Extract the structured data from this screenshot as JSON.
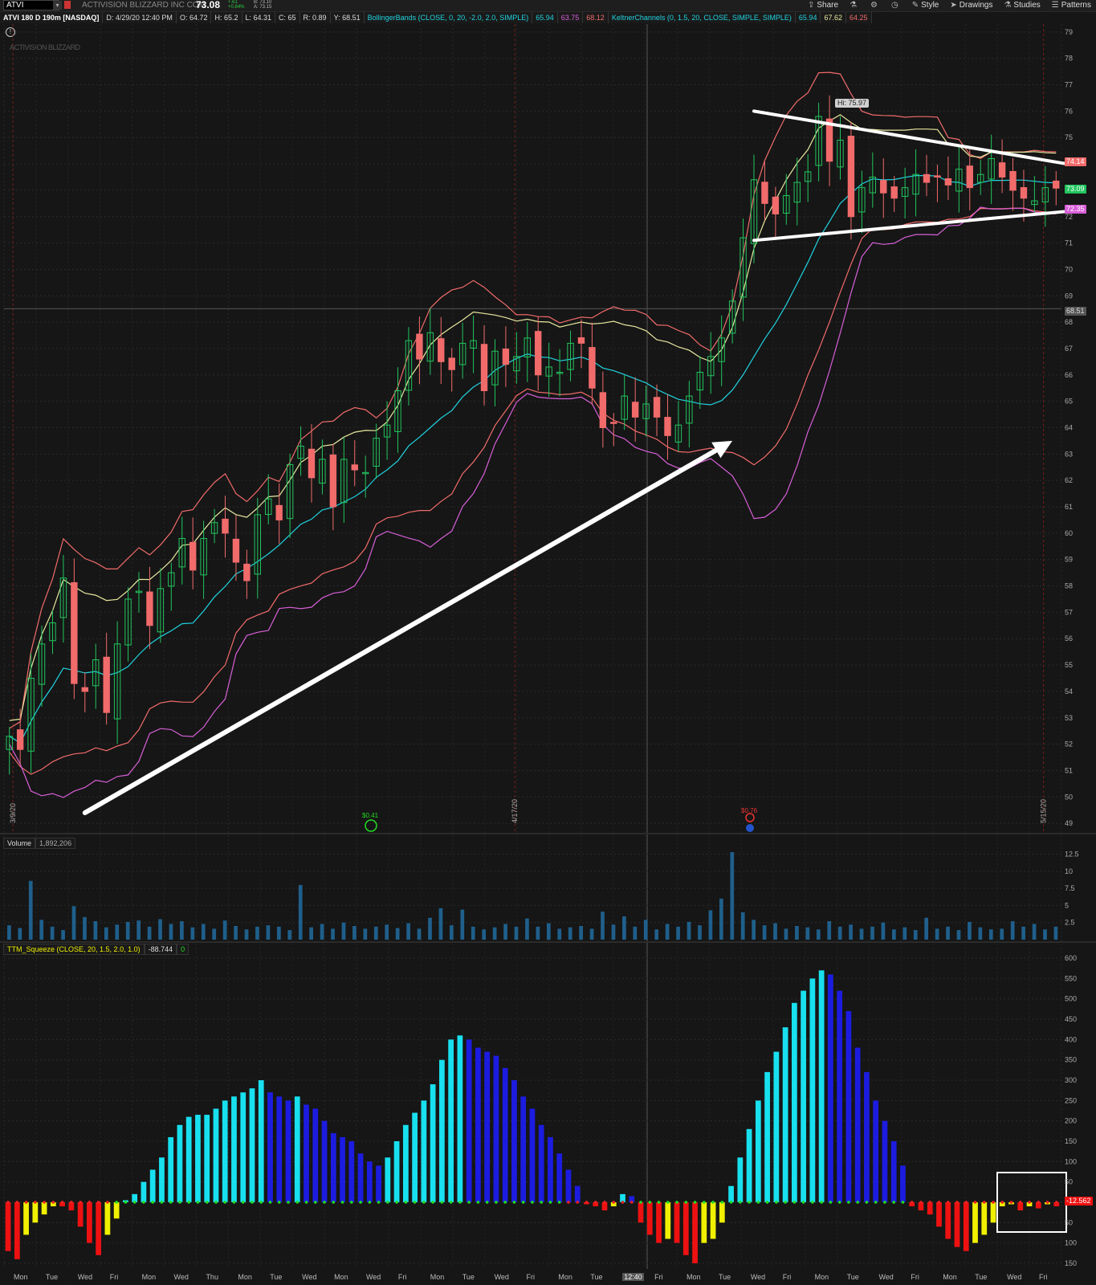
{
  "header": {
    "symbol": "ATVI",
    "company": "ACTIVISION BLIZZARD INC COM",
    "last": "73.08",
    "change": "+.61",
    "change_pct": "+0.84%",
    "bid": "B: 73.10",
    "ask": "A: 73.15",
    "buttons": [
      "Share",
      "Style",
      "Drawings",
      "Studies",
      "Patterns"
    ]
  },
  "infobar": {
    "title": "ATVI 180 D 190m [NASDAQ]",
    "date": "D: 4/29/20 12:40 PM",
    "open": "O: 64.72",
    "high": "H: 65.2",
    "low": "L: 64.31",
    "close": "C: 65",
    "range": "R: 0.89",
    "y": "Y: 68.51",
    "bb_label": "BollingerBands (CLOSE, 0, 20, -2.0, 2.0, SIMPLE)",
    "bb_mid": "65.94",
    "bb_low": "63.75",
    "bb_up": "68.12",
    "kc_label": "KeltnerChannels (0, 1.5, 20, CLOSE, SIMPLE, SIMPLE)",
    "kc_mid": "65.94",
    "kc_up": "67.62",
    "kc_low": "64.25"
  },
  "watermark": "ACTIVISION BLIZZARD",
  "hi_label": "Hi: 75.97",
  "price_tags": {
    "upper": "74.14",
    "last": "73.09",
    "lower": "72.35",
    "cursor": "68.51",
    "squeeze": "-12.562"
  },
  "dividends": {
    "first": "$0.41",
    "second": "$0.76"
  },
  "date_markers": [
    "3/9/20",
    "4/17/20",
    "5/15/20"
  ],
  "volume_label": "Volume",
  "volume_value": "1,892,206",
  "ttm_label": "TTM_Squeeze (CLOSE, 20, 1.5, 2.0, 1.0)",
  "ttm_value": "-88.744",
  "ttm_alert": "0",
  "x_labels": [
    "Mon",
    "Tue",
    "Wed",
    "Fri",
    "Mon",
    "Wed",
    "Thu",
    "Mon",
    "Tue",
    "Wed",
    "Mon",
    "Wed",
    "Fri",
    "Mon",
    "Tue",
    "Wed",
    "Fri",
    "Mon",
    "Tue",
    "12:40",
    "Fri",
    "Mon",
    "Tue",
    "Wed",
    "Fri",
    "Mon",
    "Tue",
    "Wed",
    "Fri",
    "Mon",
    "Tue",
    "Wed",
    "Fri"
  ],
  "colors": {
    "up": "#22c55e",
    "down": "#f26b6b",
    "bb_mid": "#20d3e0",
    "bb_band": "#e8e8a0",
    "kc_upper": "#f26b6b",
    "kc_lower": "#d85fd8",
    "vol": "#1f5f8b",
    "sq_cyan": "#18e0ef",
    "sq_blue": "#1c1ce0",
    "sq_red": "#ee1111",
    "sq_yellow": "#f0f000",
    "dot_green": "#22dd22",
    "dot_red": "#ee2222"
  },
  "chart_data": [
    {
      "type": "candlestick",
      "title": "ATVI 180 D 190m [NASDAQ]",
      "y_ticks": [
        49,
        50,
        51,
        52,
        53,
        54,
        55,
        56,
        57,
        58,
        59,
        60,
        61,
        62,
        63,
        64,
        65,
        66,
        67,
        68,
        69,
        70,
        71,
        72,
        73,
        74,
        75,
        76,
        77,
        78,
        79
      ],
      "ylim": [
        48.7,
        79.3
      ],
      "close_series": [
        52.3,
        51.8,
        54.5,
        55.8,
        56.6,
        58.3,
        54.3,
        54.0,
        55.2,
        53.2,
        55.8,
        57.5,
        57.8,
        56.5,
        57.9,
        58.5,
        59.8,
        58.6,
        59.8,
        60.4,
        60.0,
        58.9,
        58.2,
        60.7,
        61.3,
        60.5,
        62.6,
        63.3,
        62.1,
        62.8,
        61.0,
        62.8,
        62.4,
        62.3,
        63.6,
        64.1,
        65.4,
        67.3,
        66.6,
        67.6,
        66.5,
        66.2,
        67.2,
        67.3,
        65.4,
        66.9,
        66.4,
        66.7,
        67.4,
        66.0,
        66.3,
        66.1,
        67.2,
        67.2,
        65.5,
        64.0,
        64.2,
        65.2,
        64.4,
        64.9,
        64.4,
        63.7,
        64.1,
        65.2,
        66.1,
        66.7,
        67.4,
        68.8,
        71.2,
        73.4,
        72.5,
        72.1,
        72.8,
        73.3,
        73.7,
        75.8,
        74.1,
        74.9,
        72.0,
        73.1,
        73.5,
        72.9,
        72.7,
        73.1,
        73.6,
        73.3,
        73.5,
        73.2,
        73.8,
        73.1,
        73.6,
        74.2,
        73.5,
        73.0,
        72.7,
        72.6,
        73.1,
        73.08
      ],
      "upper_trendline": {
        "from": [
          69,
          76.0
        ],
        "to": [
          98,
          74.0
        ]
      },
      "lower_trendline": {
        "from": [
          69,
          71.1
        ],
        "to": [
          98,
          72.2
        ]
      },
      "arrow": {
        "from": [
          7,
          49.4
        ],
        "to": [
          67,
          63.5
        ]
      },
      "annotation": "Hi: 75.97"
    },
    {
      "type": "bar",
      "title": "Volume",
      "y_ticks": [
        2.5,
        5,
        7.5,
        10,
        12.5
      ],
      "ylim": [
        0,
        12.8
      ],
      "values_millions": [
        2.1,
        1.7,
        8.6,
        2.9,
        1.9,
        1.4,
        4.9,
        3.3,
        2.7,
        1.8,
        2.2,
        2.6,
        2.8,
        1.9,
        3.0,
        2.3,
        2.7,
        1.8,
        2.3,
        1.6,
        2.8,
        2.0,
        1.5,
        1.9,
        2.1,
        1.9,
        1.4,
        8.0,
        1.8,
        2.3,
        1.6,
        2.5,
        2.0,
        1.6,
        1.9,
        2.2,
        1.7,
        2.4,
        1.6,
        3.2,
        4.6,
        2.1,
        4.4,
        1.9,
        1.5,
        1.8,
        2.3,
        1.9,
        3.1,
        1.9,
        2.4,
        1.6,
        1.8,
        2.0,
        1.6,
        4.1,
        2.2,
        3.4,
        1.9,
        2.9,
        1.5,
        2.3,
        1.9,
        2.6,
        2.1,
        4.3,
        6.0,
        12.8,
        4.0,
        2.9,
        2.1,
        2.4,
        1.6,
        2.0,
        1.8,
        1.5,
        2.7,
        1.9,
        2.2,
        1.6,
        1.9,
        2.5,
        1.5,
        1.8,
        1.4,
        3.2,
        1.6,
        1.9,
        1.4,
        2.6,
        1.8,
        1.5,
        1.6,
        2.7,
        1.9,
        2.3,
        1.5,
        1.9
      ]
    },
    {
      "type": "bar",
      "title": "TTM_Squeeze (CLOSE, 20, 1.5, 2.0, 1.0)",
      "y_ticks": [
        -150,
        -100,
        -50,
        0,
        50,
        100,
        150,
        200,
        250,
        300,
        350,
        400,
        450,
        500,
        550,
        600
      ],
      "ylim": [
        -160,
        610
      ],
      "values": [
        -120,
        -140,
        -80,
        -50,
        -30,
        -10,
        -10,
        -20,
        -60,
        -100,
        -130,
        -80,
        -40,
        5,
        20,
        50,
        80,
        110,
        160,
        190,
        210,
        215,
        215,
        230,
        250,
        260,
        270,
        280,
        300,
        270,
        260,
        250,
        260,
        240,
        230,
        200,
        170,
        160,
        150,
        120,
        100,
        90,
        110,
        150,
        190,
        220,
        250,
        290,
        350,
        400,
        410,
        400,
        380,
        370,
        360,
        330,
        300,
        260,
        230,
        190,
        160,
        120,
        80,
        40,
        -5,
        -10,
        -20,
        -10,
        20,
        15,
        -50,
        -80,
        -100,
        -90,
        -100,
        -130,
        -150,
        -100,
        -90,
        -50,
        40,
        110,
        180,
        250,
        320,
        370,
        430,
        490,
        520,
        550,
        570,
        560,
        520,
        470,
        380,
        320,
        250,
        200,
        150,
        90,
        -10,
        -20,
        -30,
        -60,
        -90,
        -110,
        -120,
        -100,
        -80,
        -50,
        -10,
        -5,
        -20,
        -10,
        -15,
        -5,
        -10
      ]
    }
  ]
}
